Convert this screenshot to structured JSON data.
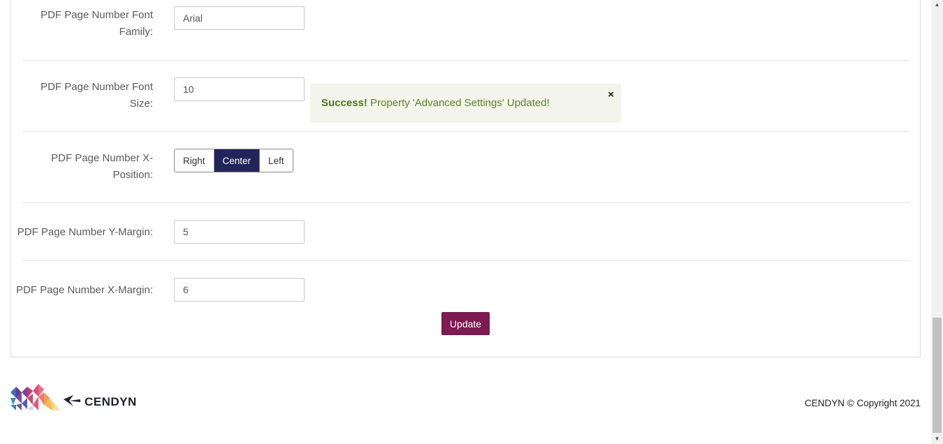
{
  "form": {
    "font_family": {
      "label_line1": "PDF Page Number Font",
      "label_line2": "Family:",
      "value": "Arial"
    },
    "font_size": {
      "label_line1": "PDF Page Number Font",
      "label_line2": "Size:",
      "value": "10"
    },
    "x_position": {
      "label_line1": "PDF Page Number X-",
      "label_line2": "Position:",
      "options": [
        "Right",
        "Center",
        "Left"
      ],
      "selected": "Center"
    },
    "y_margin": {
      "label": "PDF Page Number Y-Margin:",
      "value": "5"
    },
    "x_margin": {
      "label": "PDF Page Number X-Margin:",
      "value": "6"
    },
    "update_label": "Update"
  },
  "alert": {
    "strong": "Success!",
    "message": " Property 'Advanced Settings' Updated!",
    "close": "×"
  },
  "footer": {
    "logo_text": "CENDYN",
    "copyright": "CENDYN © Copyright 2021"
  },
  "colors": {
    "accent_navy": "#22245a",
    "accent_plum": "#7d1b52",
    "success_text": "#5d7f2a",
    "success_bg": "#f3f5ec"
  }
}
